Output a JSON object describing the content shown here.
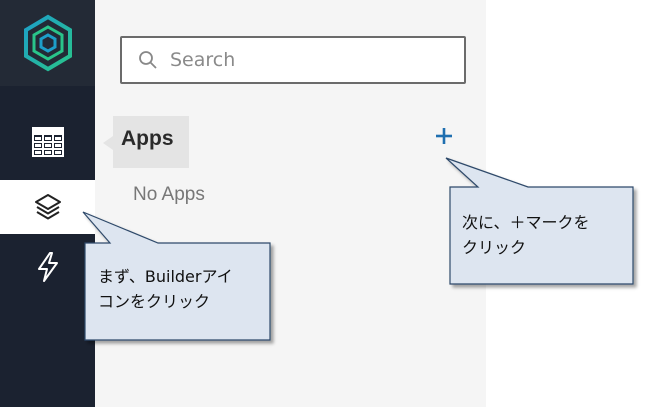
{
  "search": {
    "placeholder": "Search"
  },
  "apps": {
    "title": "Apps",
    "empty_text": "No Apps"
  },
  "callouts": {
    "first": {
      "line1": "まず、Builderアイ",
      "line2": "コンをクリック"
    },
    "second": {
      "line1": "次に、＋マークを",
      "line2": "クリック"
    }
  },
  "colors": {
    "rail_bg": "#1b2230",
    "logo_bg": "#232a36",
    "panel_bg": "#f5f5f5",
    "accent": "#1f6fb0",
    "logo_green": "#29c48a",
    "logo_teal": "#1d9fc9",
    "callout_fill": "#dde5f0",
    "callout_border": "#2f4a6a"
  },
  "icons": {
    "logo": "hexagon-logo-icon",
    "nav1": "grid-icon",
    "nav2": "layers-icon",
    "nav3": "lightning-icon",
    "search": "search-icon",
    "add": "plus-icon"
  }
}
